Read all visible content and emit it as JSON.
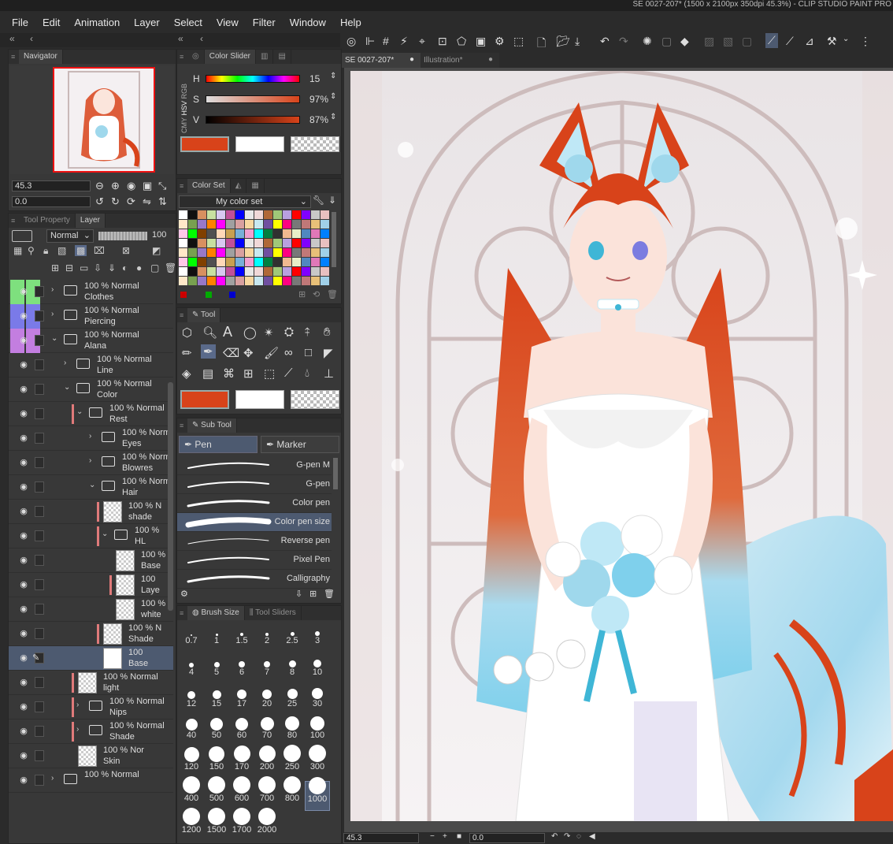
{
  "titlebar": {
    "text": "SE 0027-207* (1500 x 2100px 350dpi 45.3%)  - CLIP STUDIO PAINT PRO"
  },
  "menu": [
    "File",
    "Edit",
    "Animation",
    "Layer",
    "Select",
    "View",
    "Filter",
    "Window",
    "Help"
  ],
  "navigator": {
    "title": "Navigator",
    "zoom": "45.3",
    "angle": "0.0"
  },
  "color_slider": {
    "title": "Color Slider",
    "modes": [
      "RGB",
      "HSV",
      "CMY"
    ],
    "rows": [
      {
        "label": "H",
        "value": "15"
      },
      {
        "label": "S",
        "value": "97%"
      },
      {
        "label": "V",
        "value": "87%"
      }
    ],
    "main_color": "#d8431a",
    "sub_color": "#ffffff"
  },
  "color_set": {
    "title": "Color Set",
    "dropdown": "My color set"
  },
  "tool": {
    "title": "Tool"
  },
  "sub_tool": {
    "title": "Sub Tool",
    "tabs": [
      "Pen",
      "Marker"
    ],
    "items": [
      "G-pen M",
      "G-pen",
      "Color pen",
      "Color pen size",
      "Reverse pen",
      "Pixel Pen",
      "Calligraphy"
    ],
    "selected": "Color pen size"
  },
  "brush_size": {
    "title": "Brush Size",
    "second_tab": "Tool Sliders",
    "sizes": [
      "0.7",
      "1",
      "1.5",
      "2",
      "2.5",
      "3",
      "4",
      "5",
      "6",
      "7",
      "8",
      "10",
      "12",
      "15",
      "17",
      "20",
      "25",
      "30",
      "40",
      "50",
      "60",
      "70",
      "80",
      "100",
      "120",
      "150",
      "170",
      "200",
      "250",
      "300",
      "400",
      "500",
      "600",
      "700",
      "800",
      "1000",
      "1200",
      "1500",
      "1700",
      "2000"
    ],
    "selected": "1000"
  },
  "layer_panel": {
    "tab_inactive": "Tool Property",
    "tab_active": "Layer",
    "blend_mode": "Normal",
    "opacity": "100",
    "layers": [
      {
        "l1": "100 % Normal",
        "l2": "Clothes",
        "indent": 0,
        "type": "folder",
        "open": false,
        "color": "#7ee07e"
      },
      {
        "l1": "100 % Normal",
        "l2": "Piercing",
        "indent": 0,
        "type": "folder",
        "open": false,
        "color": "#7a7ae8"
      },
      {
        "l1": "100 % Normal",
        "l2": "Alana",
        "indent": 0,
        "type": "folder",
        "open": true,
        "color": "#c37ee0"
      },
      {
        "l1": "100 % Normal",
        "l2": "Line",
        "indent": 1,
        "type": "folder",
        "open": false
      },
      {
        "l1": "100 % Normal",
        "l2": "Color",
        "indent": 1,
        "type": "folder",
        "open": true
      },
      {
        "l1": "100 % Normal",
        "l2": "Rest",
        "indent": 2,
        "type": "folder",
        "open": true,
        "clip": true
      },
      {
        "l1": "100 % Norm",
        "l2": "Eyes",
        "indent": 3,
        "type": "folder",
        "open": false
      },
      {
        "l1": "100 % Norm",
        "l2": "Blowres",
        "indent": 3,
        "type": "folder",
        "open": false
      },
      {
        "l1": "100 % Norm",
        "l2": "Hair",
        "indent": 3,
        "type": "folder",
        "open": true
      },
      {
        "l1": "100 % N",
        "l2": "shade",
        "indent": 4,
        "type": "layer",
        "clip": true
      },
      {
        "l1": "100 %",
        "l2": "HL",
        "indent": 4,
        "type": "folder",
        "open": true,
        "clip": true
      },
      {
        "l1": "100 %",
        "l2": "Base",
        "indent": 5,
        "type": "layer"
      },
      {
        "l1": "100",
        "l2": "Laye",
        "indent": 5,
        "type": "layer",
        "clip": true
      },
      {
        "l1": "100 %",
        "l2": "white",
        "indent": 5,
        "type": "layer"
      },
      {
        "l1": "100 % N",
        "l2": "Shade",
        "indent": 4,
        "type": "layer",
        "clip": true
      },
      {
        "l1": "100",
        "l2": "Base",
        "indent": 4,
        "type": "layer",
        "selected": true
      },
      {
        "l1": "100 % Normal",
        "l2": "light",
        "indent": 2,
        "type": "layer",
        "clip": true
      },
      {
        "l1": "100 % Normal",
        "l2": "Nips",
        "indent": 2,
        "type": "folder",
        "open": false,
        "clip": true
      },
      {
        "l1": "100 % Normal",
        "l2": "Shade",
        "indent": 2,
        "type": "folder",
        "open": false,
        "clip": true
      },
      {
        "l1": "100 % Nor",
        "l2": "Skin",
        "indent": 2,
        "type": "layer"
      },
      {
        "l1": "100 % Normal",
        "l2": "",
        "indent": 0,
        "type": "folder",
        "open": false
      }
    ]
  },
  "canvas_tabs": [
    {
      "label": "SE 0027-207*",
      "active": true
    },
    {
      "label": "Illustration*",
      "active": false
    }
  ],
  "status": {
    "zoom": "45.3",
    "angle": "0.0"
  }
}
